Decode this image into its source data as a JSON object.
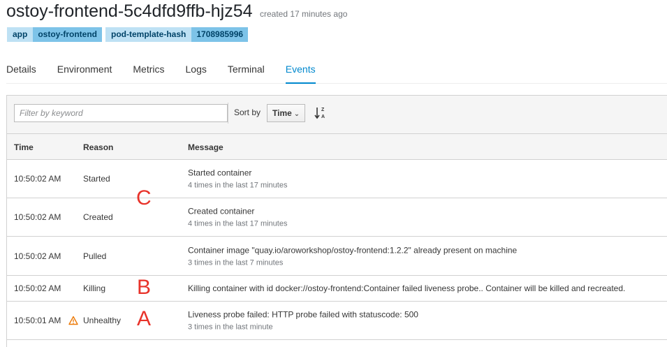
{
  "pod": {
    "name": "ostoy-frontend-5c4dfd9ffb-hjz54",
    "created": "created 17 minutes ago"
  },
  "labels": [
    {
      "key": "app",
      "value": "ostoy-frontend"
    },
    {
      "key": "pod-template-hash",
      "value": "1708985996"
    }
  ],
  "tabs": [
    "Details",
    "Environment",
    "Metrics",
    "Logs",
    "Terminal",
    "Events"
  ],
  "active_tab": "Events",
  "toolbar": {
    "filter_placeholder": "Filter by keyword",
    "sort_by_label": "Sort by",
    "sort_value": "Time",
    "sort_icon": "sort-alpha-icon"
  },
  "table": {
    "headers": [
      "Time",
      "Reason",
      "Message"
    ],
    "rows": [
      {
        "time": "10:50:02 AM",
        "reason": "Started",
        "message": "Started container",
        "detail": "4 times in the last 17 minutes"
      },
      {
        "time": "10:50:02 AM",
        "reason": "Created",
        "message": "Created container",
        "detail": "4 times in the last 17 minutes"
      },
      {
        "time": "10:50:02 AM",
        "reason": "Pulled",
        "message": "Container image \"quay.io/aroworkshop/ostoy-frontend:1.2.2\" already present on machine",
        "detail": "3 times in the last 7 minutes"
      },
      {
        "time": "10:50:02 AM",
        "reason": "Killing",
        "message": "Killing container with id docker://ostoy-frontend:Container failed liveness probe.. Container will be killed and recreated.",
        "detail": ""
      },
      {
        "time": "10:50:01 AM",
        "reason": "Unhealthy",
        "message": "Liveness probe failed: HTTP probe failed with statuscode: 500",
        "detail": "3 times in the last minute",
        "icon": "warning-icon"
      }
    ]
  },
  "annotations": [
    "C",
    "B",
    "A"
  ],
  "colors": {
    "accent": "#0088ce",
    "warning": "#ec7a08",
    "annotation": "#e8332a",
    "label_key_bg": "#bee1f4",
    "label_value_bg": "#7dc3e8"
  }
}
